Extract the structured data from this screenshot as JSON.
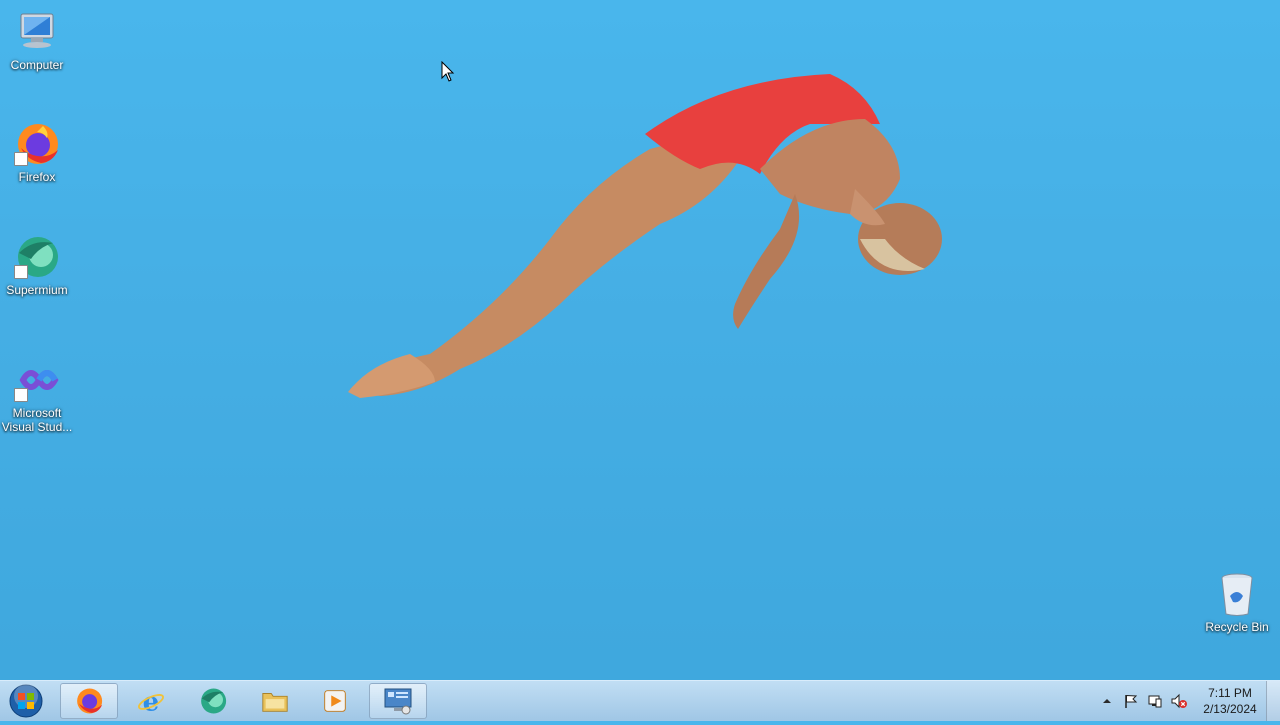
{
  "desktop": {
    "icons": [
      {
        "label": "Computer",
        "icon": "computer-icon"
      },
      {
        "label": "Firefox",
        "icon": "firefox-icon"
      },
      {
        "label": "Supermium",
        "icon": "supermium-icon"
      },
      {
        "label": "Microsoft Visual Stud...",
        "icon": "visual-studio-icon"
      },
      {
        "label": "Recycle Bin",
        "icon": "recycle-bin-icon"
      }
    ],
    "wallpaper": "diver-wallpaper"
  },
  "taskbar": {
    "start": {
      "icon": "windows-start-orb-icon"
    },
    "pinned": [
      {
        "name": "firefox",
        "icon": "firefox-icon",
        "active": true
      },
      {
        "name": "internet-explorer",
        "icon": "internet-explorer-icon",
        "active": false
      },
      {
        "name": "supermium",
        "icon": "supermium-icon",
        "active": false
      },
      {
        "name": "file-explorer",
        "icon": "folder-icon",
        "active": false
      },
      {
        "name": "media-player",
        "icon": "media-player-icon",
        "active": false
      },
      {
        "name": "remote-desktop",
        "icon": "remote-desktop-icon",
        "active": true
      }
    ],
    "tray": {
      "icons": [
        "show-hidden-icons-icon",
        "action-center-flag-icon",
        "network-icon",
        "volume-muted-icon"
      ],
      "time": "7:11 PM",
      "date": "2/13/2024"
    }
  },
  "colors": {
    "sky": "#45aee4",
    "swimsuit": "#e8403e",
    "skin": "#c88a62"
  }
}
